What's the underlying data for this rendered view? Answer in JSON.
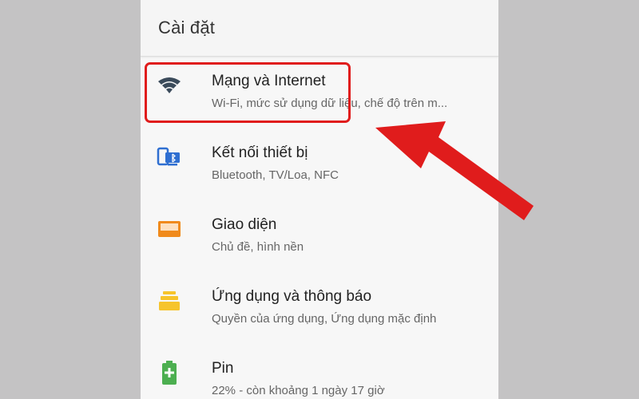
{
  "header": {
    "title": "Cài đặt"
  },
  "settings": {
    "items": [
      {
        "title": "Mạng và Internet",
        "subtitle": "Wi-Fi, mức sử dụng dữ liệu, chế độ trên m...",
        "icon": "wifi-icon"
      },
      {
        "title": "Kết nối thiết bị",
        "subtitle": "Bluetooth, TV/Loa, NFC",
        "icon": "connected-devices-icon"
      },
      {
        "title": "Giao diện",
        "subtitle": "Chủ đề, hình nền",
        "icon": "display-icon"
      },
      {
        "title": "Ứng dụng và thông báo",
        "subtitle": "Quyền của ứng dụng, Ứng dụng mặc định",
        "icon": "apps-icon"
      },
      {
        "title": "Pin",
        "subtitle": "22% - còn khoảng 1 ngày 17 giờ",
        "icon": "battery-icon"
      }
    ]
  },
  "colors": {
    "annotation_red": "#e01c1c",
    "wifi_icon": "#3a4a5a",
    "devices_icon": "#2f6fd1",
    "display_icon": "#f08a1c",
    "apps_icon": "#f6c42c",
    "battery_icon": "#4caf50"
  }
}
